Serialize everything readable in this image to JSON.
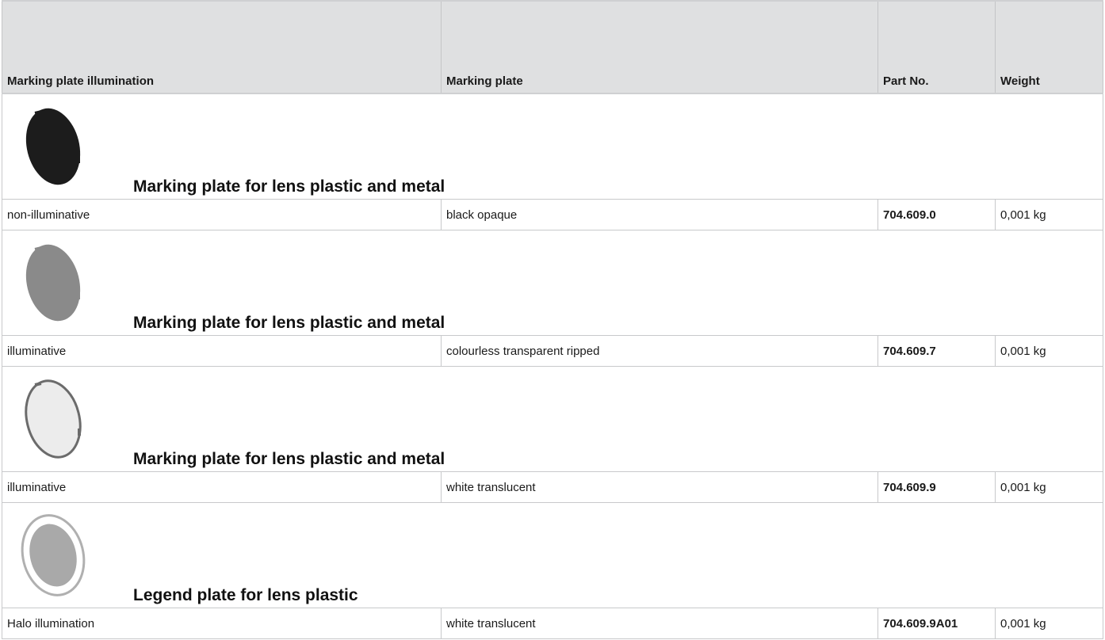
{
  "headers": {
    "illumination": "Marking plate illumination",
    "plate": "Marking plate",
    "part": "Part No.",
    "weight": "Weight"
  },
  "products": [
    {
      "title": "Marking plate for lens plastic and metal",
      "icon": "black-opaque-plate-icon",
      "plate_color": "#1c1c1c",
      "row": {
        "illumination": "non-illuminative",
        "plate": "black opaque",
        "part": "704.609.0",
        "weight": "0,001 kg"
      }
    },
    {
      "title": "Marking plate for lens plastic and metal",
      "icon": "grey-ripped-plate-icon",
      "plate_color": "#8a8a8a",
      "row": {
        "illumination": "illuminative",
        "plate": "colourless transparent ripped",
        "part": "704.609.7",
        "weight": "0,001 kg"
      }
    },
    {
      "title": "Marking plate for lens plastic and metal",
      "icon": "white-translucent-plate-icon",
      "plate_color": "#ececec",
      "row": {
        "illumination": "illuminative",
        "plate": "white translucent",
        "part": "704.609.9",
        "weight": "0,001 kg"
      }
    },
    {
      "title": "Legend plate for lens plastic",
      "icon": "halo-legend-plate-icon",
      "plate_color": "#a9a9a9",
      "row": {
        "illumination": "Halo illumination",
        "plate": "white translucent",
        "part": "704.609.9A01",
        "weight": "0,001 kg"
      }
    }
  ]
}
